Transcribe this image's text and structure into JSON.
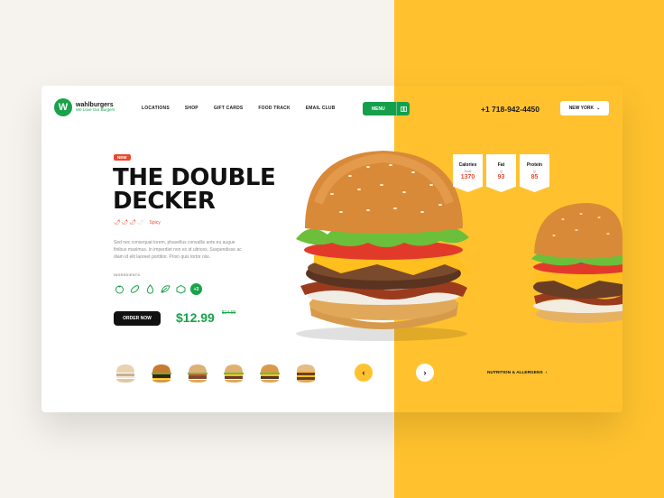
{
  "brand": {
    "name": "wahlburgers",
    "tagline": "We Love Our Burgers"
  },
  "nav": {
    "items": [
      "LOCATIONS",
      "SHOP",
      "GIFT CARDS",
      "FOOD TRACK",
      "EMAIL CLUB"
    ]
  },
  "menu_button": {
    "label": "MENU"
  },
  "phone": "+1 718-942-4450",
  "city_select": {
    "value": "NEW YORK"
  },
  "product": {
    "badge": "NEW",
    "title": "THE DOUBLE DECKER",
    "spicy_label": "Spicy",
    "spicy_level": 3,
    "spicy_max": 4,
    "description": "Sed nec consequat lorem, phasellus convallis ante eu augue finibus maximus. In imperdiet non ex id ultrices. Suspendisse ac diam id elit laoreet porttitor. Proin quis tortor nisi.",
    "ingredients_label": "INGREDIENTS",
    "ingredients_more": "+3",
    "order_label": "ORDER NOW",
    "price": "$12.99",
    "old_price": "$14.99"
  },
  "stats": [
    {
      "label": "Calories",
      "unit": "Kcal",
      "value": "1370"
    },
    {
      "label": "Fat",
      "unit": "g",
      "value": "93"
    },
    {
      "label": "Protein",
      "unit": "g",
      "value": "85"
    }
  ],
  "nutrition_link": "NUTRITION & ALLERGENS",
  "colors": {
    "accent_green": "#18a34a",
    "accent_yellow": "#ffc22e",
    "accent_red": "#e84a2e"
  }
}
